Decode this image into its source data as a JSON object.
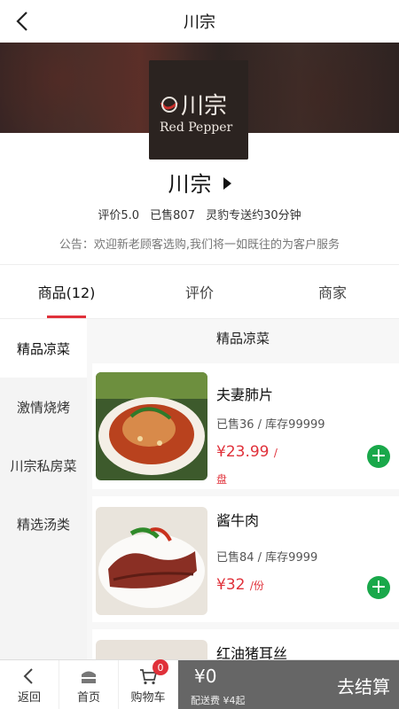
{
  "header": {
    "title": "川宗"
  },
  "shop": {
    "name": "川宗",
    "logo_text_cn": "川宗",
    "logo_text_en": "Red Pepper",
    "rating": "评价5.0",
    "sold": "已售807",
    "delivery": "灵豹专送约30分钟",
    "notice": "公告：欢迎新老顾客选购,我们将一如既往的为客户服务"
  },
  "tabs": [
    {
      "label": "商品(12)",
      "active": true
    },
    {
      "label": "评价",
      "active": false
    },
    {
      "label": "商家",
      "active": false
    }
  ],
  "categories": [
    {
      "label": "精品凉菜",
      "active": true
    },
    {
      "label": "激情烧烤",
      "active": false
    },
    {
      "label": "川宗私房菜",
      "active": false
    },
    {
      "label": "精选汤类",
      "active": false
    }
  ],
  "section_title": "精品凉菜",
  "products": [
    {
      "name": "夫妻肺片",
      "meta": "已售36 / 库存99999",
      "price": "¥23.99",
      "unit_sep": "/",
      "unit": "盘"
    },
    {
      "name": "酱牛肉",
      "meta": "已售84 / 库存9999",
      "price": "¥32",
      "unit": "/份"
    },
    {
      "name": "红油猪耳丝"
    }
  ],
  "bottom": {
    "back": "返回",
    "home": "首页",
    "cart": "购物车",
    "cart_count": "0",
    "total": "¥0",
    "fee": "配送费 ¥4起",
    "checkout": "去结算"
  },
  "colors": {
    "accent": "#e0313a",
    "add_button": "#19a84a",
    "checkout_bar": "#666666"
  }
}
